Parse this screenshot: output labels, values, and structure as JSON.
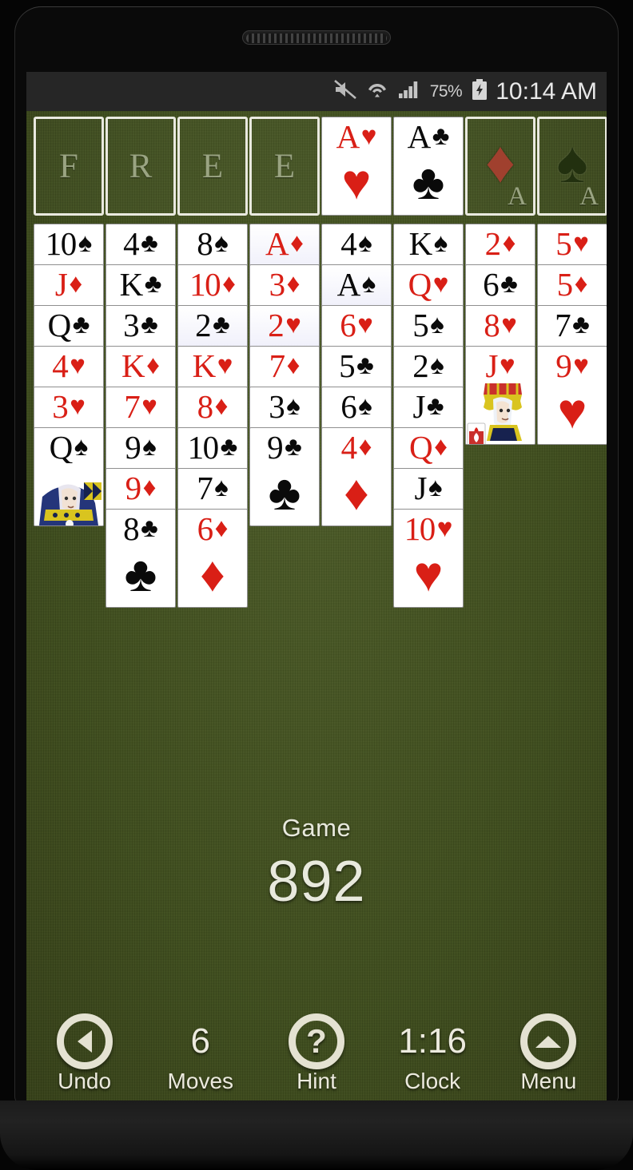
{
  "statusbar": {
    "battery_percent": "75%",
    "time": "10:14 AM",
    "icons": [
      "mute-icon",
      "wifi-icon",
      "signal-icon",
      "battery-charging-icon"
    ]
  },
  "freecells": [
    {
      "label": "F",
      "card": null
    },
    {
      "label": "R",
      "card": null
    },
    {
      "label": "E",
      "card": null
    },
    {
      "label": "E",
      "card": null
    }
  ],
  "foundations": [
    {
      "suit": "hearts",
      "suit_glyph": "♥",
      "color": "#d91f16",
      "rank": "A",
      "empty": false,
      "ghost_rank": "A"
    },
    {
      "suit": "clubs",
      "suit_glyph": "♣",
      "color": "#0a0a0a",
      "rank": "A",
      "empty": false,
      "ghost_rank": "A"
    },
    {
      "suit": "diamonds",
      "suit_glyph": "♦",
      "color": "#a0402e",
      "rank": "",
      "empty": true,
      "ghost_rank": "A"
    },
    {
      "suit": "spades",
      "suit_glyph": "♠",
      "color": "#22300f",
      "rank": "",
      "empty": true,
      "ghost_rank": "A"
    }
  ],
  "tableau": [
    {
      "column": 1,
      "cards": [
        {
          "rank": "10",
          "suit": "spades",
          "glyph": "♠",
          "color": "black",
          "highlight": false
        },
        {
          "rank": "J",
          "suit": "diamonds",
          "glyph": "♦",
          "color": "red",
          "highlight": false
        },
        {
          "rank": "Q",
          "suit": "clubs",
          "glyph": "♣",
          "color": "black",
          "highlight": false
        },
        {
          "rank": "4",
          "suit": "hearts",
          "glyph": "♥",
          "color": "red",
          "highlight": false
        },
        {
          "rank": "3",
          "suit": "hearts",
          "glyph": "♥",
          "color": "red",
          "highlight": false
        },
        {
          "rank": "Q",
          "suit": "spades",
          "glyph": "♠",
          "color": "black",
          "highlight": false,
          "face": "queen"
        }
      ]
    },
    {
      "column": 2,
      "cards": [
        {
          "rank": "4",
          "suit": "clubs",
          "glyph": "♣",
          "color": "black",
          "highlight": false
        },
        {
          "rank": "K",
          "suit": "clubs",
          "glyph": "♣",
          "color": "black",
          "highlight": false
        },
        {
          "rank": "3",
          "suit": "clubs",
          "glyph": "♣",
          "color": "black",
          "highlight": false
        },
        {
          "rank": "K",
          "suit": "diamonds",
          "glyph": "♦",
          "color": "red",
          "highlight": false
        },
        {
          "rank": "7",
          "suit": "hearts",
          "glyph": "♥",
          "color": "red",
          "highlight": false
        },
        {
          "rank": "9",
          "suit": "spades",
          "glyph": "♠",
          "color": "black",
          "highlight": false
        },
        {
          "rank": "9",
          "suit": "diamonds",
          "glyph": "♦",
          "color": "red",
          "highlight": false
        },
        {
          "rank": "8",
          "suit": "clubs",
          "glyph": "♣",
          "color": "black",
          "highlight": false
        }
      ]
    },
    {
      "column": 3,
      "cards": [
        {
          "rank": "8",
          "suit": "spades",
          "glyph": "♠",
          "color": "black",
          "highlight": false
        },
        {
          "rank": "10",
          "suit": "diamonds",
          "glyph": "♦",
          "color": "red",
          "highlight": false
        },
        {
          "rank": "2",
          "suit": "clubs",
          "glyph": "♣",
          "color": "black",
          "highlight": true
        },
        {
          "rank": "K",
          "suit": "hearts",
          "glyph": "♥",
          "color": "red",
          "highlight": false
        },
        {
          "rank": "8",
          "suit": "diamonds",
          "glyph": "♦",
          "color": "red",
          "highlight": false
        },
        {
          "rank": "10",
          "suit": "clubs",
          "glyph": "♣",
          "color": "black",
          "highlight": false
        },
        {
          "rank": "7",
          "suit": "spades",
          "glyph": "♠",
          "color": "black",
          "highlight": false
        },
        {
          "rank": "6",
          "suit": "diamonds",
          "glyph": "♦",
          "color": "red",
          "highlight": false
        }
      ]
    },
    {
      "column": 4,
      "cards": [
        {
          "rank": "A",
          "suit": "diamonds",
          "glyph": "♦",
          "color": "red",
          "highlight": true
        },
        {
          "rank": "3",
          "suit": "diamonds",
          "glyph": "♦",
          "color": "red",
          "highlight": false
        },
        {
          "rank": "2",
          "suit": "hearts",
          "glyph": "♥",
          "color": "red",
          "highlight": true
        },
        {
          "rank": "7",
          "suit": "diamonds",
          "glyph": "♦",
          "color": "red",
          "highlight": false
        },
        {
          "rank": "3",
          "suit": "spades",
          "glyph": "♠",
          "color": "black",
          "highlight": false
        },
        {
          "rank": "9",
          "suit": "clubs",
          "glyph": "♣",
          "color": "black",
          "highlight": false
        }
      ]
    },
    {
      "column": 5,
      "cards": [
        {
          "rank": "4",
          "suit": "spades",
          "glyph": "♠",
          "color": "black",
          "highlight": false
        },
        {
          "rank": "A",
          "suit": "spades",
          "glyph": "♠",
          "color": "black",
          "highlight": true
        },
        {
          "rank": "6",
          "suit": "hearts",
          "glyph": "♥",
          "color": "red",
          "highlight": false
        },
        {
          "rank": "5",
          "suit": "clubs",
          "glyph": "♣",
          "color": "black",
          "highlight": false
        },
        {
          "rank": "6",
          "suit": "spades",
          "glyph": "♠",
          "color": "black",
          "highlight": false
        },
        {
          "rank": "4",
          "suit": "diamonds",
          "glyph": "♦",
          "color": "red",
          "highlight": false
        }
      ]
    },
    {
      "column": 6,
      "cards": [
        {
          "rank": "K",
          "suit": "spades",
          "glyph": "♠",
          "color": "black",
          "highlight": false
        },
        {
          "rank": "Q",
          "suit": "hearts",
          "glyph": "♥",
          "color": "red",
          "highlight": false
        },
        {
          "rank": "5",
          "suit": "spades",
          "glyph": "♠",
          "color": "black",
          "highlight": false
        },
        {
          "rank": "2",
          "suit": "spades",
          "glyph": "♠",
          "color": "black",
          "highlight": false
        },
        {
          "rank": "J",
          "suit": "clubs",
          "glyph": "♣",
          "color": "black",
          "highlight": false
        },
        {
          "rank": "Q",
          "suit": "diamonds",
          "glyph": "♦",
          "color": "red",
          "highlight": false
        },
        {
          "rank": "J",
          "suit": "spades",
          "glyph": "♠",
          "color": "black",
          "highlight": false
        },
        {
          "rank": "10",
          "suit": "hearts",
          "glyph": "♥",
          "color": "red",
          "highlight": false
        }
      ]
    },
    {
      "column": 7,
      "cards": [
        {
          "rank": "2",
          "suit": "diamonds",
          "glyph": "♦",
          "color": "red",
          "highlight": false
        },
        {
          "rank": "6",
          "suit": "clubs",
          "glyph": "♣",
          "color": "black",
          "highlight": false
        },
        {
          "rank": "8",
          "suit": "hearts",
          "glyph": "♥",
          "color": "red",
          "highlight": false
        },
        {
          "rank": "J",
          "suit": "hearts",
          "glyph": "♥",
          "color": "red",
          "highlight": false,
          "face": "jack"
        }
      ]
    },
    {
      "column": 8,
      "cards": [
        {
          "rank": "5",
          "suit": "hearts",
          "glyph": "♥",
          "color": "red",
          "highlight": false
        },
        {
          "rank": "5",
          "suit": "diamonds",
          "glyph": "♦",
          "color": "red",
          "highlight": false
        },
        {
          "rank": "7",
          "suit": "clubs",
          "glyph": "♣",
          "color": "black",
          "highlight": false
        },
        {
          "rank": "9",
          "suit": "hearts",
          "glyph": "♥",
          "color": "red",
          "highlight": false
        }
      ]
    }
  ],
  "game": {
    "label": "Game",
    "number": "892"
  },
  "toolbar": {
    "undo_label": "Undo",
    "moves_value": "6",
    "moves_label": "Moves",
    "hint_label": "Hint",
    "hint_glyph": "?",
    "clock_value": "1:16",
    "clock_label": "Clock",
    "menu_label": "Menu"
  },
  "colors": {
    "felt": "#42521f",
    "card_red": "#d91f16",
    "card_black": "#0a0a0a",
    "highlight": "#c9c9ec",
    "slot_border": "#e9e9df"
  }
}
